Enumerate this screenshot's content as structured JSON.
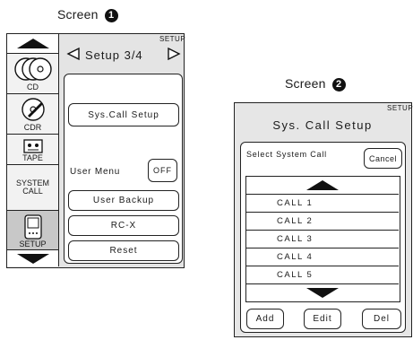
{
  "screen1": {
    "caption": "Screen",
    "caption_num": "1",
    "setup_tag": "SETUP",
    "nav_title": "Setup 3/4",
    "sources": [
      {
        "label": "CD",
        "icon": "cd-icon"
      },
      {
        "label": "CDR",
        "icon": "cdr-icon"
      },
      {
        "label": "TAPE",
        "icon": "tape-icon"
      },
      {
        "label": "SYSTEM CALL",
        "icon": ""
      },
      {
        "label": "SETUP",
        "icon": "remote-icon"
      }
    ],
    "system_call_line1": "SYSTEM",
    "system_call_line2": "CALL",
    "sys_call_setup_label": "Sys.Call Setup",
    "user_menu_label": "User Menu",
    "user_menu_toggle": "OFF",
    "user_backup_label": "User Backup",
    "rcx_label": "RC-X",
    "reset_label": "Reset"
  },
  "screen2": {
    "caption": "Screen",
    "caption_num": "2",
    "setup_tag": "SETUP",
    "title": "Sys. Call Setup",
    "select_label": "Select System Call",
    "cancel_label": "Cancel",
    "calls": [
      "CALL  1",
      "CALL  2",
      "CALL  3",
      "CALL  4",
      "CALL  5"
    ],
    "add_label": "Add",
    "edit_label": "Edit",
    "del_label": "Del"
  }
}
